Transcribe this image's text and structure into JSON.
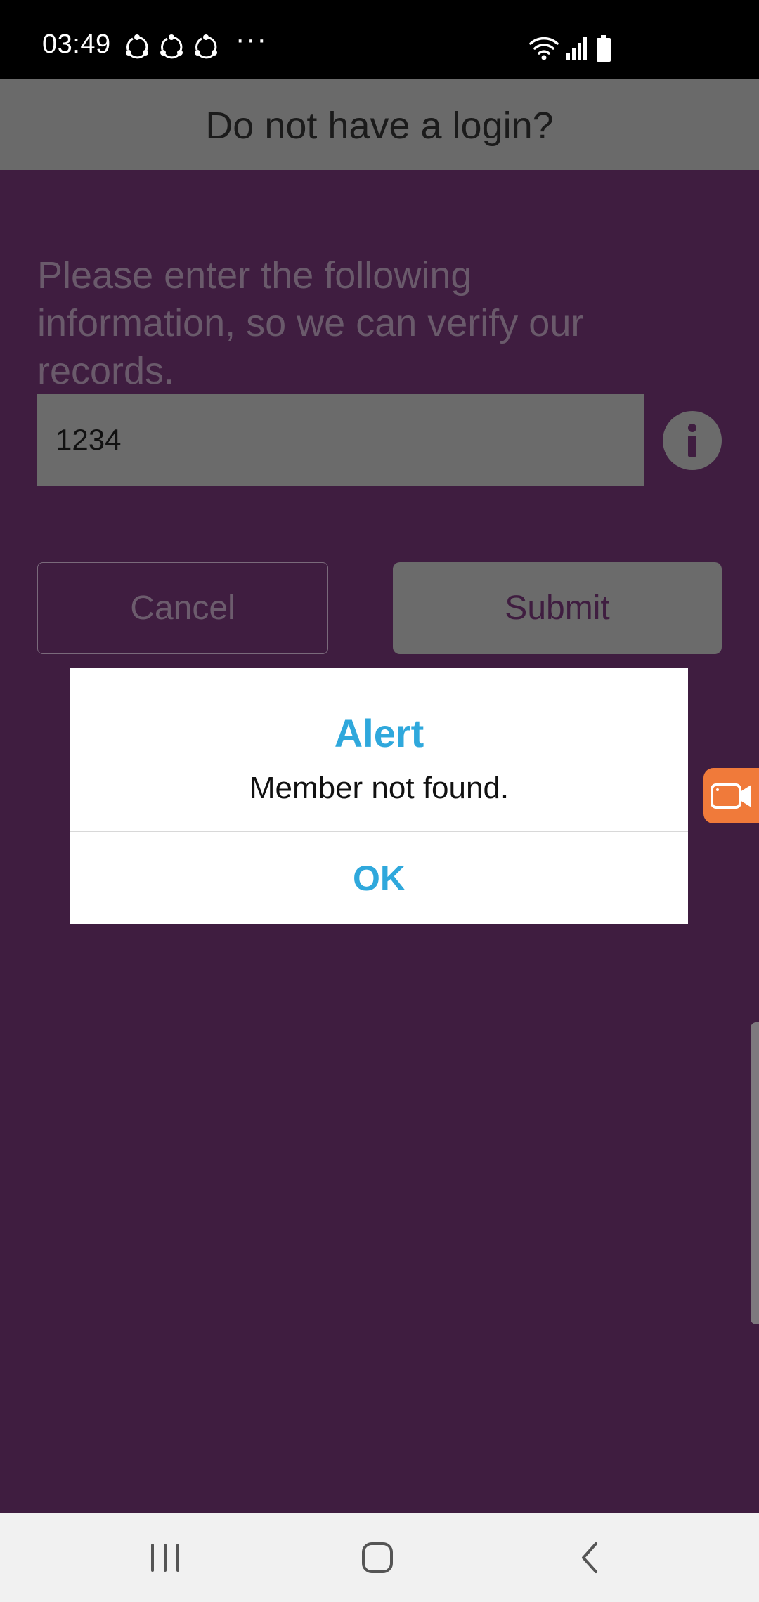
{
  "status_bar": {
    "time": "03:49",
    "more": "···",
    "icons": [
      "sync-icon",
      "sync-icon",
      "sync-icon",
      "wifi-icon",
      "signal-icon",
      "battery-icon"
    ]
  },
  "header": {
    "title": "Do not have a login?"
  },
  "form": {
    "instruction": "Please enter the following information, so we can verify our records.",
    "input_value": "1234",
    "cancel_label": "Cancel",
    "submit_label": "Submit"
  },
  "dialog": {
    "title": "Alert",
    "message": "Member not found.",
    "ok_label": "OK"
  },
  "colors": {
    "background": "#3f1d40",
    "accent": "#2fa8dc",
    "recorder": "#f07a3a"
  },
  "nav_bar": {
    "icons": [
      "recent-apps-icon",
      "home-icon",
      "back-icon"
    ]
  }
}
